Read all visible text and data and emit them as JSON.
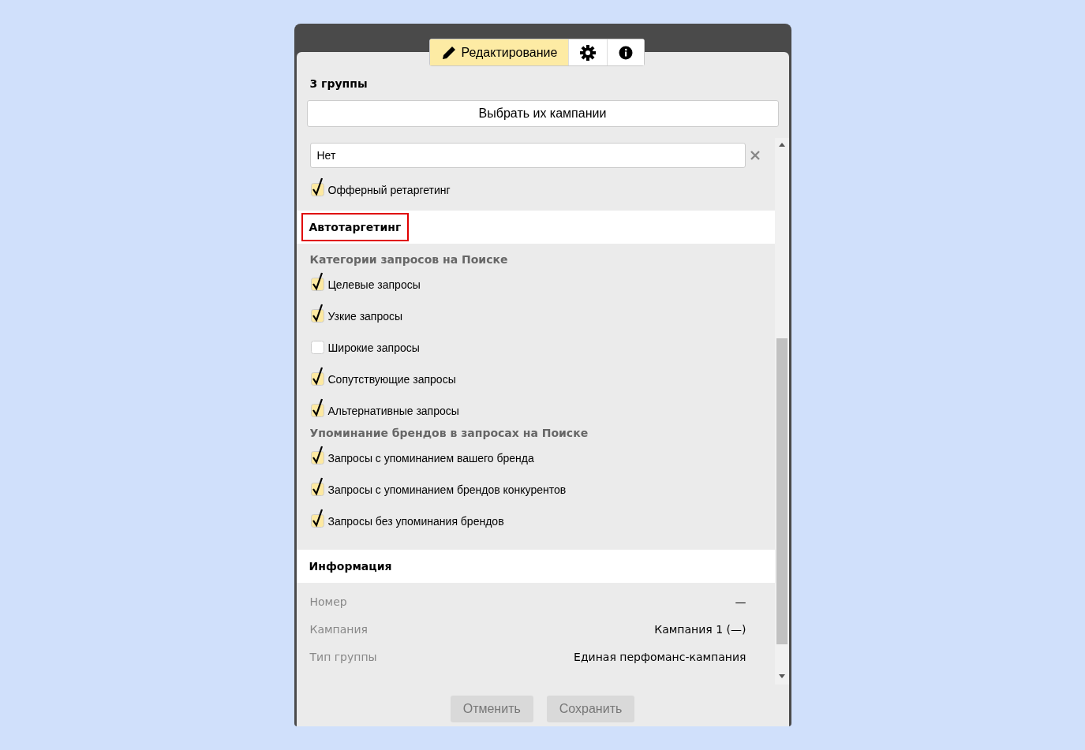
{
  "tabs": [
    {
      "kind": "edit",
      "label": "Редактирование",
      "selected": true
    },
    {
      "kind": "settings",
      "selected": false
    },
    {
      "kind": "info",
      "selected": false
    }
  ],
  "group_count": "3 группы",
  "select_campaigns_button": "Выбрать их кампании",
  "field": {
    "value": "Нет"
  },
  "offer_retargeting": {
    "label": "Офферный ретаргетинг",
    "checked": true
  },
  "sections": [
    {
      "title": "Автотаргетинг",
      "highlighted": true,
      "groups": [
        {
          "title": "Категории запросов на Поиске",
          "items": [
            {
              "label": "Целевые запросы",
              "checked": true
            },
            {
              "label": "Узкие запросы",
              "checked": true
            },
            {
              "label": "Широкие запросы",
              "checked": false
            },
            {
              "label": "Сопутствующие запросы",
              "checked": true
            },
            {
              "label": "Альтернативные запросы",
              "checked": true
            }
          ]
        },
        {
          "title": "Упоминание брендов в запросах на Поиске",
          "items": [
            {
              "label": "Запросы с упоминанием вашего бренда",
              "checked": true
            },
            {
              "label": "Запросы с упоминанием брендов конкурентов",
              "checked": true
            },
            {
              "label": "Запросы без упоминания брендов",
              "checked": true
            }
          ]
        }
      ]
    }
  ],
  "information": {
    "title": "Информация",
    "highlighted": false,
    "rows": [
      {
        "label": "Номер",
        "value": "—"
      },
      {
        "label": "Кампания",
        "value": "Кампания 1 (—)"
      },
      {
        "label": "Тип группы",
        "value": "Единая перфоманс-кампания"
      }
    ]
  },
  "buttons": [
    {
      "label": "Отменить",
      "disabled": true
    },
    {
      "label": "Сохранить",
      "disabled": true
    }
  ]
}
